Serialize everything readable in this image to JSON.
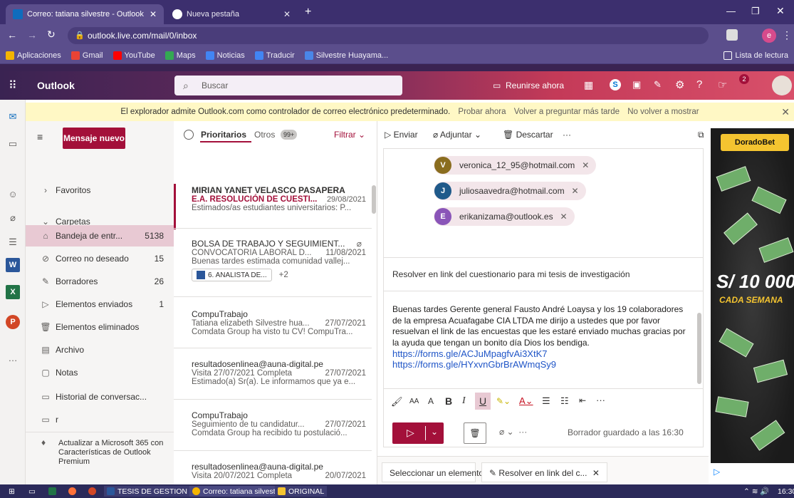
{
  "browser": {
    "tabs": [
      {
        "label": "Correo: tatiana silvestre - Outlook"
      },
      {
        "label": "Nueva pestaña"
      }
    ],
    "url": "outlook.live.com/mail/0/inbox",
    "profile_initial": "e",
    "bookmarks": [
      "Aplicaciones",
      "Gmail",
      "YouTube",
      "Maps",
      "Noticias",
      "Traducir",
      "Silvestre Huayama..."
    ],
    "reading_list": "Lista de lectura"
  },
  "outlook": {
    "brand": "Outlook",
    "search_placeholder": "Buscar",
    "meet_now": "Reunirse ahora",
    "badge_count": "2"
  },
  "banner": {
    "text": "El explorador admite Outlook.com como controlador de correo electrónico predeterminado.",
    "try_now": "Probar ahora",
    "ask_later": "Volver a preguntar más tarde",
    "never": "No volver a mostrar"
  },
  "folders": {
    "new_mail": "Mensaje nuevo",
    "favorites": "Favoritos",
    "folders_label": "Carpetas",
    "items": [
      {
        "label": "Bandeja de entr...",
        "count": "5138"
      },
      {
        "label": "Correo no deseado",
        "count": "15"
      },
      {
        "label": "Borradores",
        "count": "26"
      },
      {
        "label": "Elementos enviados",
        "count": "1"
      },
      {
        "label": "Elementos eliminados",
        "count": ""
      },
      {
        "label": "Archivo",
        "count": ""
      },
      {
        "label": "Notas",
        "count": ""
      },
      {
        "label": "Historial de conversac...",
        "count": ""
      },
      {
        "label": "r",
        "count": ""
      }
    ],
    "upgrade": "Actualizar a Microsoft 365 con Características de Outlook Premium"
  },
  "list": {
    "focused": "Prioritarios",
    "other": "Otros",
    "other_badge": "99+",
    "filter": "Filtrar",
    "messages": [
      {
        "from": "MIRIAN YANET VELASCO PASAPERA",
        "subject": "E.A. RESOLUCIÓN DE CUESTI...",
        "date": "29/08/2021",
        "preview": "Estimados/as estudiantes universitarios: P..."
      },
      {
        "from": "BOLSA DE TRABAJO Y SEGUIMIENT...",
        "subject": "CONVOCATORIA LABORAL D...",
        "date": "11/08/2021",
        "preview": "Buenas tardes estimada comunidad vallej...",
        "attachment": "6. ANALISTA DE...",
        "more": "+2"
      },
      {
        "from": "CompuTrabajo",
        "subject": "Tatiana elizabeth Silvestre hua...",
        "date": "27/07/2021",
        "preview": "Comdata Group ha visto tu CV! CompuTra..."
      },
      {
        "from": "resultadosenlinea@auna-digital.pe",
        "subject": "Visita 27/07/2021 Completa",
        "date": "27/07/2021",
        "preview": "Estimado(a) Sr(a). Le informamos que ya e..."
      },
      {
        "from": "CompuTrabajo",
        "subject": "Seguimiento de tu candidatur...",
        "date": "27/07/2021",
        "preview": "Comdata Group ha recibido tu postulació..."
      },
      {
        "from": "resultadosenlinea@auna-digital.pe",
        "subject": "Visita 20/07/2021 Completa",
        "date": "20/07/2021",
        "preview": ""
      }
    ]
  },
  "reading": {
    "send": "Enviar",
    "attach": "Adjuntar",
    "discard": "Descartar",
    "recipients": [
      {
        "initial": "V",
        "email": "veronica_12_95@hotmail.com",
        "color": "#8a6d1f"
      },
      {
        "initial": "J",
        "email": "juliosaavedra@hotmail.com",
        "color": "#1f5a8a"
      },
      {
        "initial": "E",
        "email": "erikanizama@outlook.es",
        "color": "#8a55b8"
      }
    ],
    "subject": "Resolver en link del cuestionario para mi tesis de investigación",
    "body": "Buenas tardes Gerente general Fausto André Loaysa y los 19 colaboradores de la empresa Acuafagabe CIA LTDA me dirijo a ustedes que por favor resuelvan el link de las encuestas que les estaré enviado muchas gracias por la ayuda que tengan un bonito día Dios los bendiga.",
    "link1": "https://forms.gle/ACJuMpagfvAi3XtK7",
    "link2": "https://forms.gle/HYxvnGbrBrAWmqSy9",
    "draft_saved": "Borrador guardado a las 16:30",
    "bottom_tab1": "Seleccionar un elemento p...",
    "bottom_tab2": "Resolver en link del c..."
  },
  "ad": {
    "brand": "DoradoBet",
    "amount": "S/ 10 000",
    "period": "CADA SEMANA"
  },
  "taskbar": {
    "items": [
      "TESIS DE GESTION FI...",
      "Correo: tatiana silvest...",
      "ORIGINAL"
    ],
    "time": "16:30"
  },
  "colors": {
    "accent": "#a3103a",
    "chrome": "#5b4e8c",
    "banner": "#fff8c5"
  }
}
